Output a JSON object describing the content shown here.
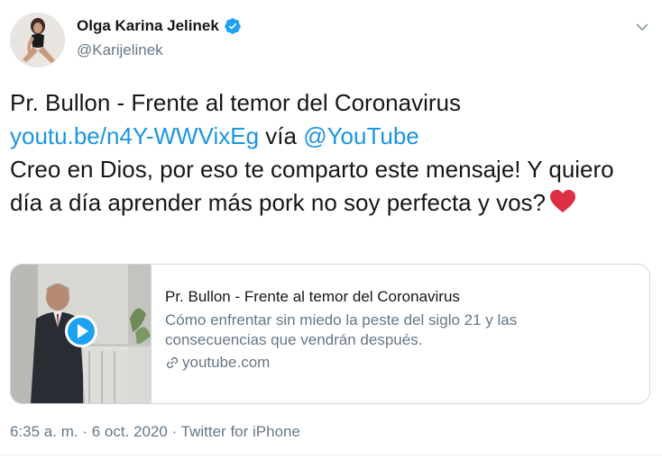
{
  "author": {
    "name": "Olga Karina Jelinek",
    "handle": "@Karijelinek",
    "verified": true
  },
  "tweet": {
    "line1": "Pr. Bullon - Frente al temor del Coronavirus",
    "link_text": "youtu.be/n4Y-WWVixEg",
    "via_text": " vía ",
    "mention": "@YouTube",
    "body": "Creo en Dios, por eso te comparto este mensaje! Y quiero día a día aprender más pork no soy perfecta y vos?",
    "emoji": "heart"
  },
  "card": {
    "title": "Pr. Bullon - Frente al temor del Coronavirus",
    "description": "Cómo enfrentar sin miedo la peste del siglo 21 y las consecuencias que vendrán después.",
    "domain": "youtube.com"
  },
  "meta": {
    "time": "6:35 a. m.",
    "separator": " · ",
    "date": "6 oct. 2020",
    "source": "Twitter for iPhone"
  },
  "colors": {
    "link": "#1b95e0",
    "secondary_text": "#657786",
    "border": "#ccd6dd",
    "heart": "#e0245e"
  }
}
